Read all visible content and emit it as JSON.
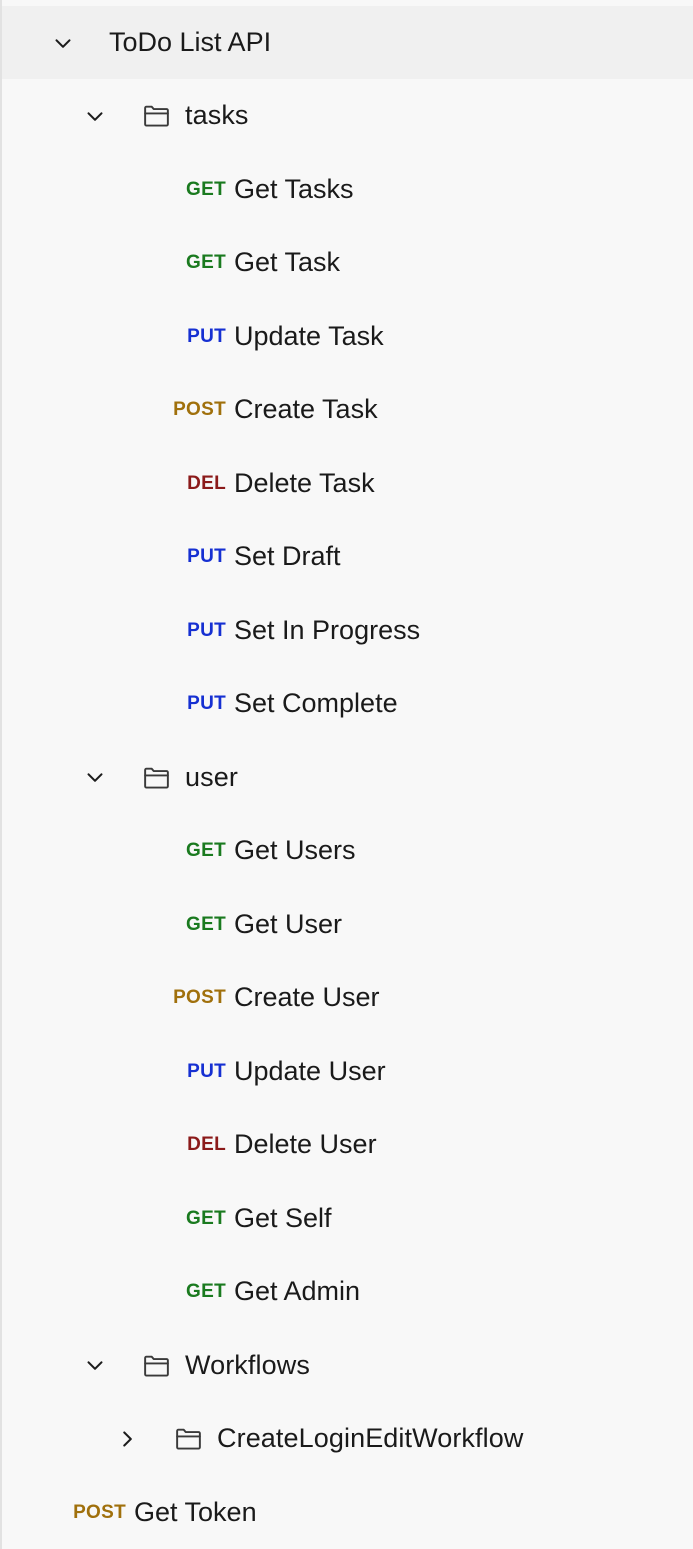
{
  "panel": {
    "name": "api-collection-tree",
    "background_color": "#f8f8f8",
    "header_background_color": "#f0f0f0",
    "border_color": "#e2e2e2"
  },
  "method_colors": {
    "GET": "#1a7a1f",
    "PUT": "#1630d2",
    "POST": "#a0700c",
    "DEL": "#8b1a1a"
  },
  "icons": {
    "chevron_down": "chevron-down-icon",
    "chevron_right": "chevron-right-icon",
    "folder": "folder-icon"
  },
  "collection": {
    "title": "ToDo List API",
    "expanded": true
  },
  "folders": {
    "tasks": {
      "label": "tasks",
      "expanded": true
    },
    "user": {
      "label": "user",
      "expanded": true
    },
    "workflows": {
      "label": "Workflows",
      "expanded": true
    },
    "create_login_edit_workflow": {
      "label": "CreateLoginEditWorkflow",
      "expanded": false
    }
  },
  "tasks_requests": [
    {
      "method": "GET",
      "label": "Get Tasks"
    },
    {
      "method": "GET",
      "label": "Get Task"
    },
    {
      "method": "PUT",
      "label": "Update Task"
    },
    {
      "method": "POST",
      "label": "Create Task"
    },
    {
      "method": "DEL",
      "label": "Delete Task"
    },
    {
      "method": "PUT",
      "label": "Set Draft"
    },
    {
      "method": "PUT",
      "label": "Set In Progress"
    },
    {
      "method": "PUT",
      "label": "Set Complete"
    }
  ],
  "user_requests": [
    {
      "method": "GET",
      "label": "Get Users"
    },
    {
      "method": "GET",
      "label": "Get User"
    },
    {
      "method": "POST",
      "label": "Create User"
    },
    {
      "method": "PUT",
      "label": "Update User"
    },
    {
      "method": "DEL",
      "label": "Delete User"
    },
    {
      "method": "GET",
      "label": "Get Self"
    },
    {
      "method": "GET",
      "label": "Get Admin"
    }
  ],
  "root_requests": [
    {
      "method": "POST",
      "label": "Get Token"
    }
  ]
}
